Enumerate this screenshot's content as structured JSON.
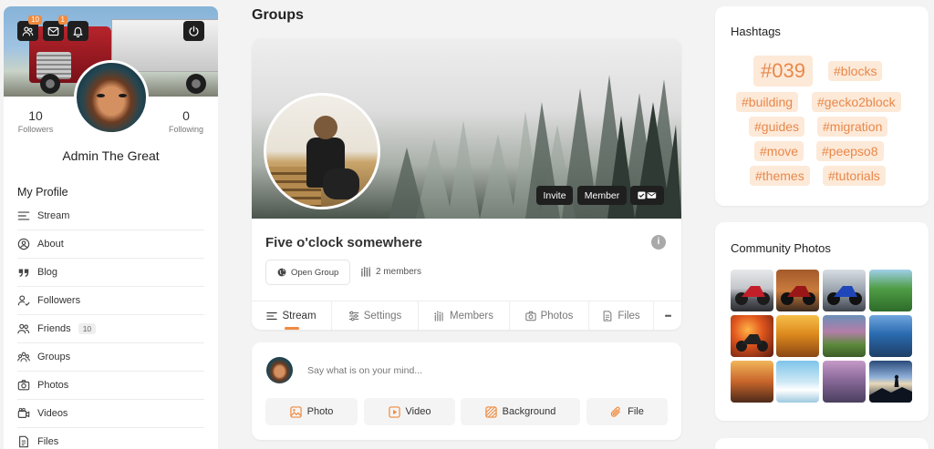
{
  "header": {
    "notifications": {
      "friends_count": "10",
      "messages_count": "1"
    }
  },
  "profile": {
    "followers_count": "10",
    "followers_label": "Followers",
    "following_count": "0",
    "following_label": "Following",
    "name": "Admin The Great",
    "section_title": "My Profile",
    "menu": [
      {
        "label": "Stream",
        "icon": "stream-icon"
      },
      {
        "label": "About",
        "icon": "user-circle-icon"
      },
      {
        "label": "Blog",
        "icon": "quote-icon"
      },
      {
        "label": "Followers",
        "icon": "follower-icon"
      },
      {
        "label": "Friends",
        "icon": "friends-icon",
        "count": "10"
      },
      {
        "label": "Groups",
        "icon": "groups-icon"
      },
      {
        "label": "Photos",
        "icon": "camera-icon"
      },
      {
        "label": "Videos",
        "icon": "video-icon"
      },
      {
        "label": "Files",
        "icon": "file-icon"
      }
    ]
  },
  "page": {
    "title": "Groups"
  },
  "group": {
    "name": "Five o'clock somewhere",
    "invite_label": "Invite",
    "member_label": "Member",
    "privacy_label": "Open Group",
    "members_label": "2 members",
    "info_glyph": "i",
    "tabs": [
      "Stream",
      "Settings",
      "Members",
      "Photos",
      "Files"
    ],
    "more_glyph": "•••"
  },
  "postbox": {
    "placeholder": "Say what is on your mind...",
    "buttons": [
      "Photo",
      "Video",
      "Background",
      "File"
    ]
  },
  "hashtags": {
    "title": "Hashtags",
    "tags": [
      "#039",
      "#blocks",
      "#building",
      "#gecko2block",
      "#guides",
      "#migration",
      "#move",
      "#peepso8",
      "#themes",
      "#tutorials"
    ]
  },
  "community_photos": {
    "title": "Community Photos",
    "photos": [
      "motorcycle-photo",
      "motorcycle-photo",
      "motorcycle-photo",
      "landscape-photo",
      "motorcycle-photo",
      "autumn-photo",
      "lake-photo",
      "waterfall-photo",
      "autumn-photo",
      "glacier-photo",
      "mountain-photo",
      "silhouette-photo"
    ]
  },
  "colors": {
    "accent": "#f08a3e",
    "tag_bg": "#fde9d8",
    "tag_text": "#e8884a",
    "dark_button": "#1f1f1f"
  }
}
